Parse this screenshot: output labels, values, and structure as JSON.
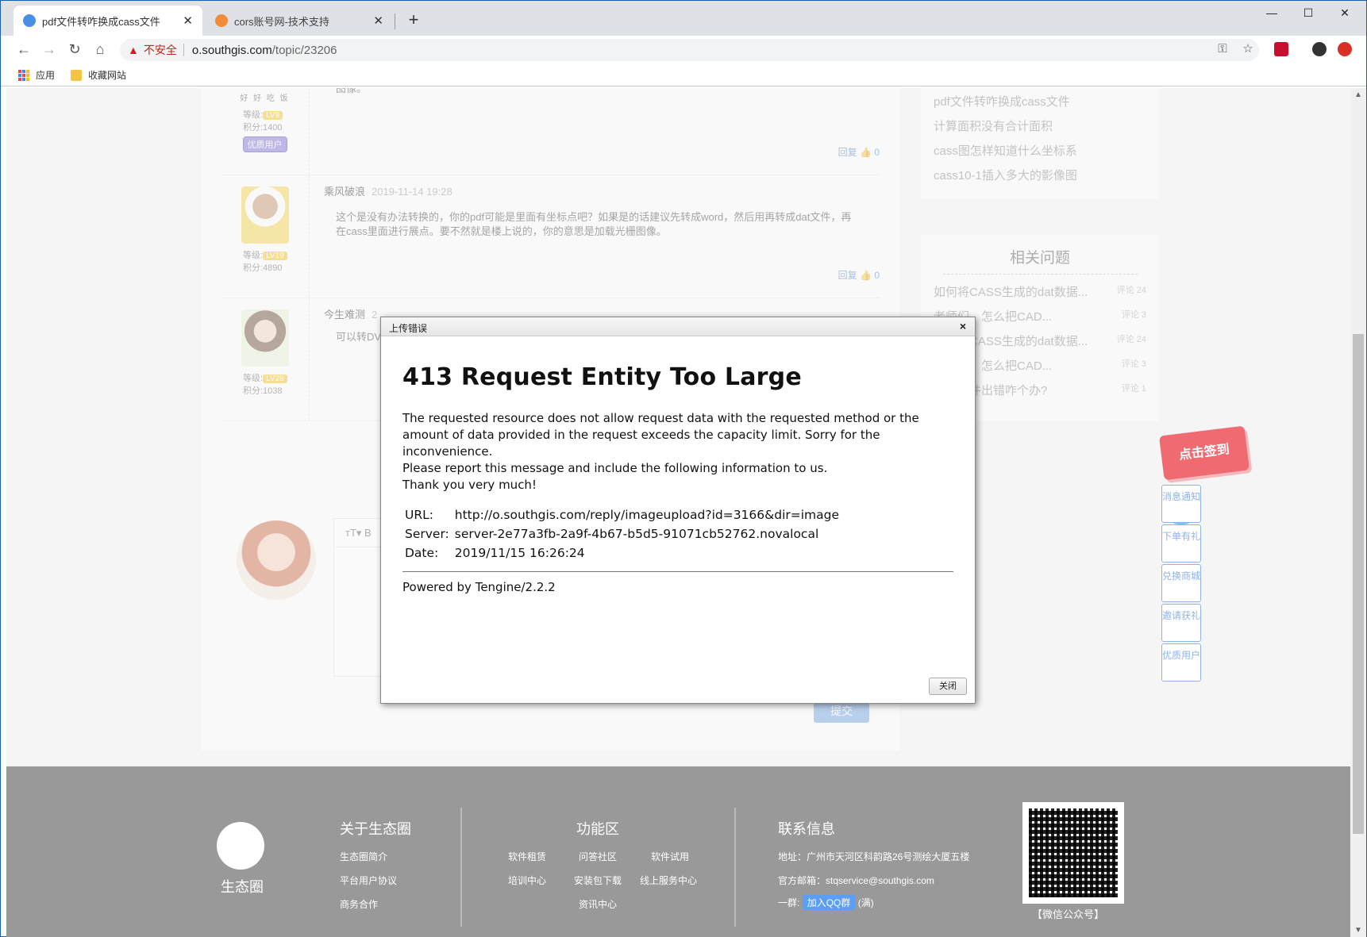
{
  "browser": {
    "tabs": [
      {
        "title": "pdf文件转咋换成cass文件",
        "favicon_color": "#4a90e2"
      },
      {
        "title": "cors账号网-技术支持",
        "favicon_color": "#f28c38"
      }
    ],
    "address": {
      "warning": "不安全",
      "host": "o.southgis.com",
      "path": "/topic/23206"
    },
    "bookmarks": {
      "apps": "应用",
      "folder": "收藏网站"
    }
  },
  "page": {
    "replies": [
      {
        "author": "",
        "avatar_caption": "好 好 吃 饭",
        "level": "LV9",
        "level_label": "等级:",
        "points": "积分:1400",
        "badge": "优质用户",
        "body": "图像。",
        "reply_label": "回复",
        "likes": "0"
      },
      {
        "author": "乘风破浪",
        "time": "2019-11-14 19:28",
        "level": "LV19",
        "level_label": "等级:",
        "points": "积分:4890",
        "body": "这个是没有办法转换的，你的pdf可能是里面有坐标点吧？如果是的话建议先转成word，然后用再转成dat文件，再在cass里面进行展点。要不然就是楼上说的，你的意思是加载光栅图像。",
        "reply_label": "回复",
        "likes": "0"
      },
      {
        "author": "今生难测",
        "time": "2",
        "level": "LV28",
        "level_label": "等级:",
        "points": "积分:1038",
        "body": "可以转DV"
      }
    ],
    "editor": {
      "toolbar_text": "тT▾   B",
      "submit": "提交"
    },
    "sidebar": {
      "top_links": [
        "pdf文件转咋换成cass文件",
        "计算面积没有合计面积",
        "cass图怎样知道什么坐标系",
        "cass10-1插入多大的影像图"
      ],
      "related_title": "相关问题",
      "related": [
        {
          "title": "如何将CASS生成的dat数据...",
          "count": "评论 24"
        },
        {
          "title": "老师们，怎么把CAD...",
          "count": "评论 3"
        },
        {
          "title": "如何将CASS生成的dat数据...",
          "count": "评论 24"
        },
        {
          "title": "老师们，怎么把CAD...",
          "count": "评论 3"
        },
        {
          "title": "打开文件出错咋个办?",
          "count": "评论 1"
        }
      ]
    },
    "promo": "点击签到",
    "float_buttons": [
      "消息通知",
      "下单有礼",
      "兑换商城",
      "邀请获礼",
      "优质用户"
    ],
    "footer": {
      "logo_text": "生态圈",
      "about_title": "关于生态圈",
      "about_links": [
        "生态圈简介",
        "平台用户协议",
        "商务合作"
      ],
      "func_title": "功能区",
      "func_links": [
        "软件租赁",
        "问答社区",
        "软件试用",
        "培训中心",
        "安装包下载",
        "线上服务中心",
        "资讯中心"
      ],
      "contact_title": "联系信息",
      "address": "地址：广州市天河区科韵路26号测绘大厦五楼",
      "email": "官方邮箱：stqservice@southgis.com",
      "qq_prefix": "一群:",
      "qq_button": "加入QQ群",
      "qq_suffix": "(满)",
      "qr_label": "【微信公众号】"
    }
  },
  "dialog": {
    "title": "上传错误",
    "error_heading": "413 Request Entity Too Large",
    "desc_lines": [
      "The requested resource does not allow request data with the requested method or the amount of data provided in the request exceeds the capacity limit. Sorry for the inconvenience.",
      "Please report this message and include the following information to us.",
      "Thank you very much!"
    ],
    "info": [
      {
        "key": "URL:",
        "value": "http://o.southgis.com/reply/imageupload?id=3166&dir=image"
      },
      {
        "key": "Server:",
        "value": "server-2e77a3fb-2a9f-4b67-b5d5-91071cb52762.novalocal"
      },
      {
        "key": "Date:",
        "value": "2019/11/15 16:26:24"
      }
    ],
    "powered_by": "Powered by Tengine/2.2.2",
    "close_button": "关闭"
  }
}
